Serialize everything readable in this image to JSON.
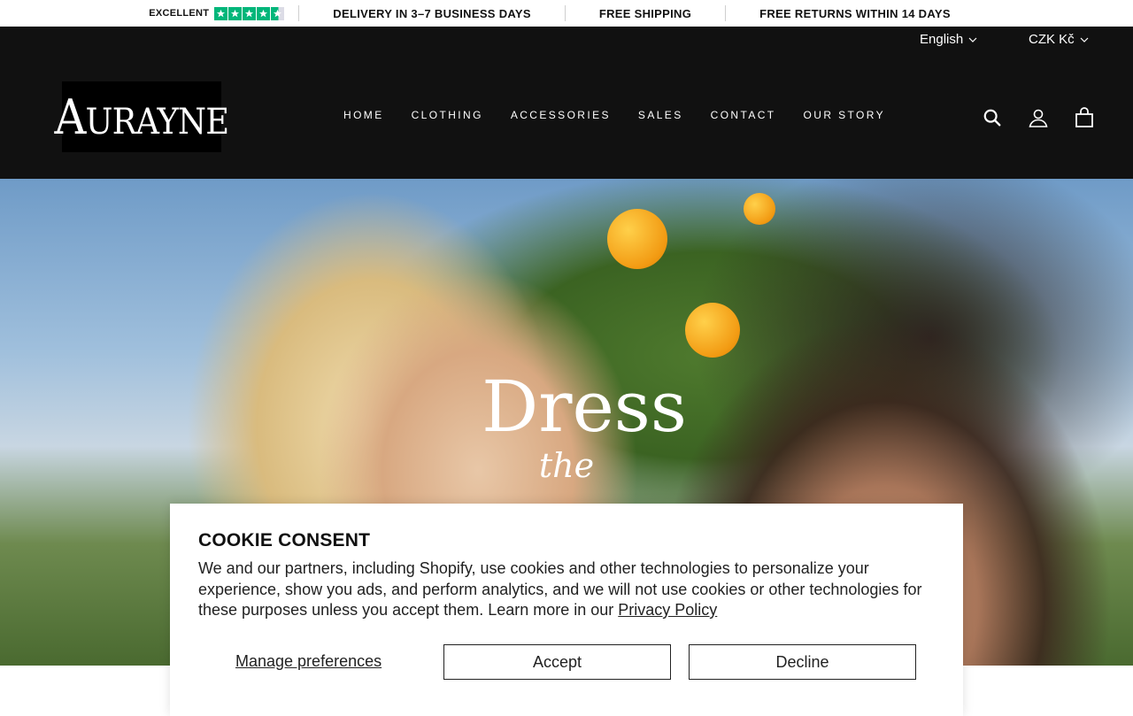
{
  "announcement": {
    "trustpilot_label": "EXCELLENT",
    "trustpilot_rating": 4.5,
    "trustpilot_color": "#00b67a",
    "messages": [
      "DELIVERY IN 3–7 BUSINESS DAYS",
      "FREE SHIPPING",
      "FREE RETURNS WITHIN 14 DAYS"
    ]
  },
  "header": {
    "language": "English",
    "currency": "CZK Kč",
    "logo_first": "A",
    "logo_rest": "URAYNE",
    "nav": [
      "HOME",
      "CLOTHING",
      "ACCESSORIES",
      "SALES",
      "CONTACT",
      "OUR STORY"
    ],
    "icons": [
      "search-icon",
      "account-icon",
      "cart-icon"
    ]
  },
  "hero": {
    "title_line1": "Dress",
    "title_line2": "the"
  },
  "cookie": {
    "title": "COOKIE CONSENT",
    "body": "We and our partners, including Shopify, use cookies and other technologies to personalize your experience, show you ads, and perform analytics, and we will not use cookies or other technologies for these purposes unless you accept them. Learn more in our ",
    "privacy_link": "Privacy Policy",
    "manage": "Manage preferences",
    "accept": "Accept",
    "decline": "Decline"
  }
}
